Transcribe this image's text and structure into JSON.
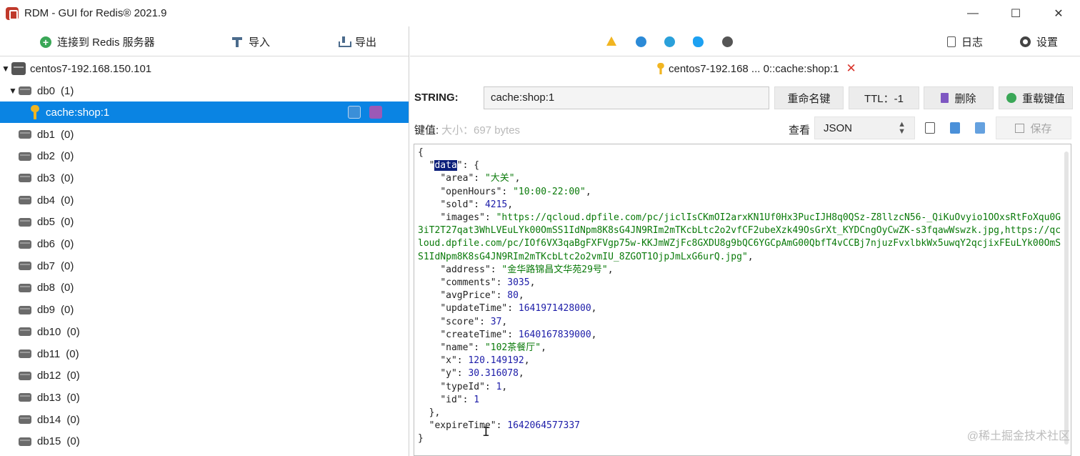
{
  "window": {
    "title": "RDM - GUI for Redis® 2021.9",
    "minimize": "—",
    "maximize": "☐",
    "close": "✕",
    "edge_char": "r"
  },
  "left_toolbar": {
    "connect_label": "连接到 Redis 服务器",
    "import_label": "导入",
    "export_label": "导出"
  },
  "tree": {
    "server": "centos7-192.168.150.101",
    "db0": {
      "name": "db0",
      "count": "(1)"
    },
    "selected_key": "cache:shop:1",
    "dbs": [
      {
        "name": "db1",
        "count": "(0)"
      },
      {
        "name": "db2",
        "count": "(0)"
      },
      {
        "name": "db3",
        "count": "(0)"
      },
      {
        "name": "db4",
        "count": "(0)"
      },
      {
        "name": "db5",
        "count": "(0)"
      },
      {
        "name": "db6",
        "count": "(0)"
      },
      {
        "name": "db7",
        "count": "(0)"
      },
      {
        "name": "db8",
        "count": "(0)"
      },
      {
        "name": "db9",
        "count": "(0)"
      },
      {
        "name": "db10",
        "count": "(0)"
      },
      {
        "name": "db11",
        "count": "(0)"
      },
      {
        "name": "db12",
        "count": "(0)"
      },
      {
        "name": "db13",
        "count": "(0)"
      },
      {
        "name": "db14",
        "count": "(0)"
      },
      {
        "name": "db15",
        "count": "(0)"
      }
    ]
  },
  "right_toolbar": {
    "log_label": "日志",
    "settings_label": "设置"
  },
  "tab": {
    "label": "centos7-192.168 ... 0::cache:shop:1",
    "close": "✕"
  },
  "key_panel": {
    "type": "STRING:",
    "key_name": "cache:shop:1",
    "rename_label": "重命名键",
    "ttl_label": "TTL：-1",
    "delete_label": "删除",
    "reload_label": "重载键值"
  },
  "value_panel": {
    "value_label": "键值:",
    "size_label": "大小：697 bytes",
    "view_label": "查看",
    "format": "JSON",
    "save_label": "保存"
  },
  "json": {
    "open_brace": "{",
    "data_key": "data",
    "data_open": ": {",
    "fields": [
      {
        "key": "area",
        "value": "\"大关\"",
        "type": "s"
      },
      {
        "key": "openHours",
        "value": "\"10:00-22:00\"",
        "type": "s"
      },
      {
        "key": "sold",
        "value": "4215",
        "type": "n"
      },
      {
        "key": "images",
        "value": "\"https://qcloud.dpfile.com/pc/jiclIsCKmOI2arxKN1Uf0Hx3PucIJH8q0QSz-Z8llzcN56-_QiKuOvyio1OOxsRtFoXqu0G3iT2T27qat3WhLVEuLYk00OmSS1IdNpm8K8sG4JN9RIm2mTKcbLtc2o2vfCF2ubeXzk49OsGrXt_KYDCngOyCwZK-s3fqawWswzk.jpg,https://qcloud.dpfile.com/pc/IOf6VX3qaBgFXFVgp75w-KKJmWZjFc8GXDU8g9bQC6YGCpAmG00QbfT4vCCBj7njuzFvxlbkWx5uwqY2qcjixFEuLYk00OmSS1IdNpm8K8sG4JN9RIm2mTKcbLtc2o2vmIU_8ZGOT1OjpJmLxG6urQ.jpg\"",
        "type": "s"
      },
      {
        "key": "address",
        "value": "\"金华路锦昌文华苑29号\"",
        "type": "s"
      },
      {
        "key": "comments",
        "value": "3035",
        "type": "n"
      },
      {
        "key": "avgPrice",
        "value": "80",
        "type": "n"
      },
      {
        "key": "updateTime",
        "value": "1641971428000",
        "type": "n"
      },
      {
        "key": "score",
        "value": "37",
        "type": "n"
      },
      {
        "key": "createTime",
        "value": "1640167839000",
        "type": "n"
      },
      {
        "key": "name",
        "value": "\"102茶餐厅\"",
        "type": "s"
      },
      {
        "key": "x",
        "value": "120.149192",
        "type": "n"
      },
      {
        "key": "y",
        "value": "30.316078",
        "type": "n"
      },
      {
        "key": "typeId",
        "value": "1",
        "type": "n"
      },
      {
        "key": "id",
        "value": "1",
        "type": "n"
      }
    ],
    "data_close": "},",
    "expire_key": "expireTime",
    "expire_value": "1642064577337",
    "close_brace": "}"
  },
  "watermark": "@稀土掘金技术社区"
}
